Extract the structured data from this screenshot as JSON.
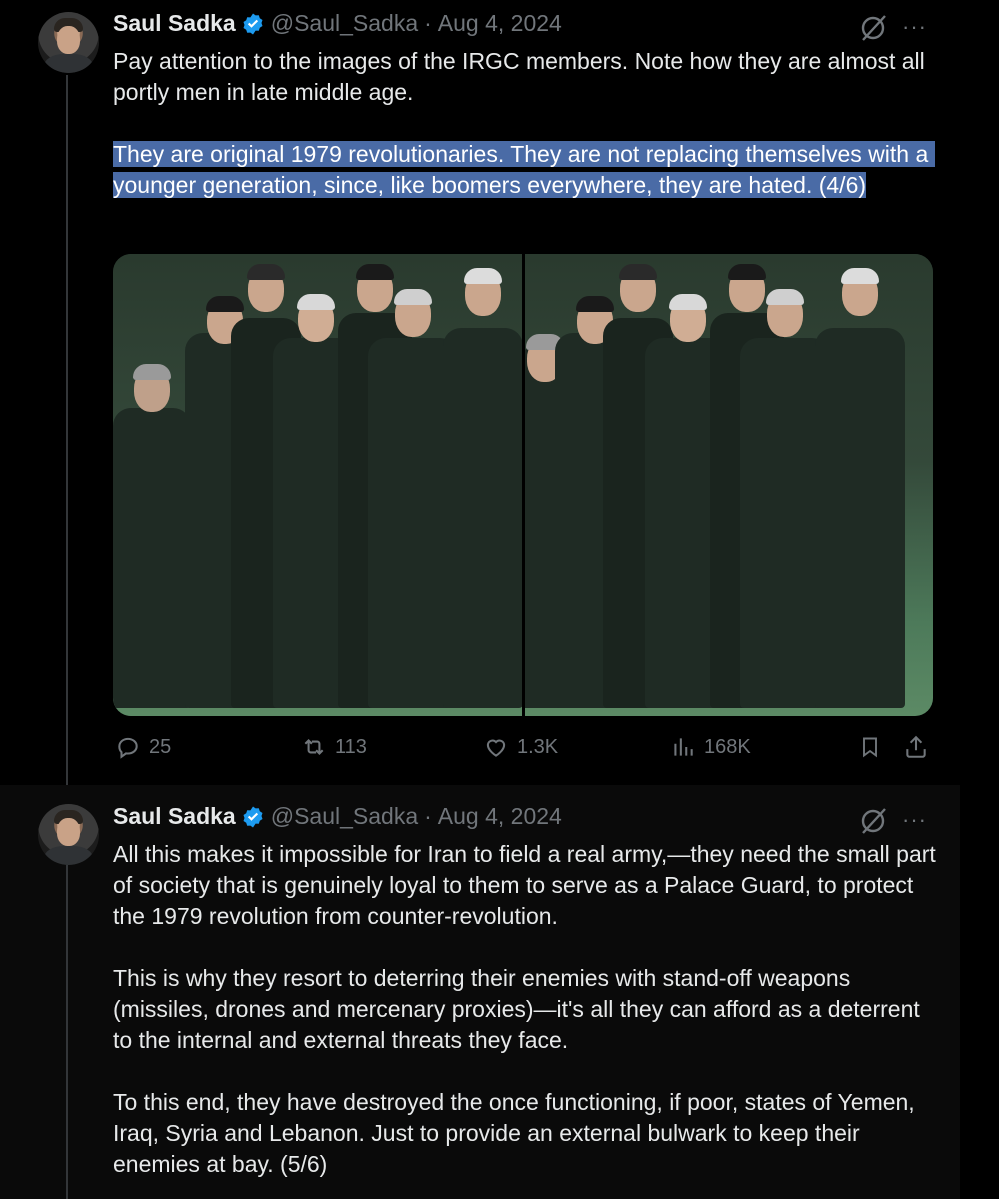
{
  "tweets": [
    {
      "author": "Saul Sadka",
      "handle": "@Saul_Sadka",
      "separator": "·",
      "date": "Aug 4, 2024",
      "more": "···",
      "paragraphs": [
        {
          "text": "Pay attention to the images of the IRGC members. Note how they are almost all portly men in late middle age.",
          "highlighted": false
        },
        {
          "text": "They are original 1979 revolutionaries. They are not replacing themselves with a younger generation, since, like boomers everywhere, they are hated. (4/6)",
          "highlighted": true
        }
      ],
      "media": {
        "description_icon": "photo-icon"
      },
      "stats": {
        "replies": "25",
        "reposts": "113",
        "likes": "1.3K",
        "views": "168K"
      }
    },
    {
      "author": "Saul Sadka",
      "handle": "@Saul_Sadka",
      "separator": "·",
      "date": "Aug 4, 2024",
      "more": "···",
      "paragraphs": [
        {
          "text": "All this makes it impossible for Iran to field a real army,—they need the small part of society that is genuinely loyal to them to serve as a Palace Guard, to protect the 1979 revolution from counter-revolution."
        },
        {
          "text": "This is why they resort to deterring their enemies with stand-off weapons (missiles, drones and mercenary proxies)—it's all they can afford as a deterrent to the internal and external threats they face."
        },
        {
          "text": "To this end, they have destroyed the once functioning, if poor, states of Yemen, Iraq, Syria and Lebanon. Just to provide an external bulwark to keep their enemies at bay. (5/6)"
        }
      ]
    }
  ],
  "colors": {
    "background": "#000000",
    "text": "#e7e9ea",
    "muted": "#71767b",
    "verified": "#1d9bf0",
    "highlight": "#4a6ba6"
  }
}
